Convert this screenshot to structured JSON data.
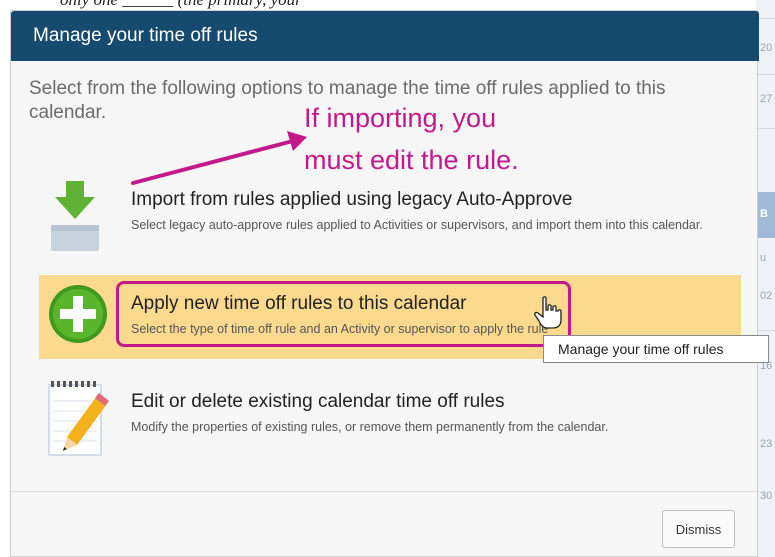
{
  "top_caption": "only one ______ (the primary, your",
  "background_calendar": {
    "cells": [
      "20",
      "27",
      "B",
      "u",
      "02",
      "16",
      "23",
      "30"
    ]
  },
  "dialog": {
    "title": "Manage your time off rules",
    "intro": "Select from the following options to manage the time off rules applied to this calendar.",
    "annotation": {
      "line1": "If importing, you",
      "line2": "must edit the rule.",
      "color": "#c3198a"
    },
    "options": [
      {
        "icon": "download-icon",
        "title": "Import from rules applied using legacy Auto-Approve",
        "description": "Select legacy auto-approve rules applied to Activities or supervisors, and import them into this calendar."
      },
      {
        "icon": "add-circle-icon",
        "title": "Apply new time off rules to this calendar",
        "description": "Select the type of time off rule and an Activity or supervisor to apply the rule to."
      },
      {
        "icon": "notepad-pencil-icon",
        "title": "Edit or delete existing calendar time off rules",
        "description": "Modify the properties of existing rules, or remove them permanently from the calendar."
      }
    ],
    "tooltip": "Manage your time off rules",
    "dismiss_label": "Dismiss"
  },
  "colors": {
    "header": "#174a6f",
    "highlight": "#fbd98e",
    "annotation": "#c3198a",
    "add_icon": "#4caa2a"
  }
}
